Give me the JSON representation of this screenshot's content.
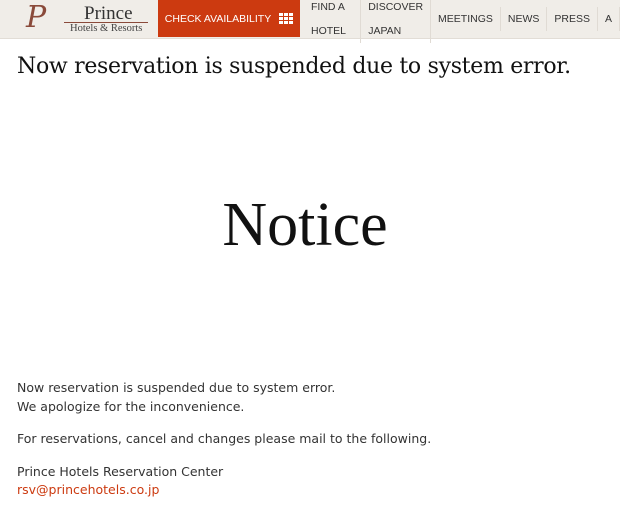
{
  "header": {
    "logo": {
      "mark": "P",
      "name": "Prince",
      "sub": "Hotels & Resorts"
    },
    "cta": "CHECK AVAILABILITY",
    "cta_icon": "grid-icon",
    "nav": [
      "FIND A HOTEL",
      "DISCOVER JAPAN",
      "MEETINGS",
      "NEWS",
      "PRESS",
      "A"
    ],
    "accent": "#cc3a10"
  },
  "main": {
    "heading": "Now reservation is suspended due to system error.",
    "notice": "Notice",
    "line1": "Now reservation is suspended due to system error.",
    "line2": "We apologize for the inconvenience.",
    "line3": "For reservations, cancel and changes please mail to the following.",
    "line4": "Prince Hotels Reservation Center",
    "email": "rsv@princehotels.co.jp"
  }
}
